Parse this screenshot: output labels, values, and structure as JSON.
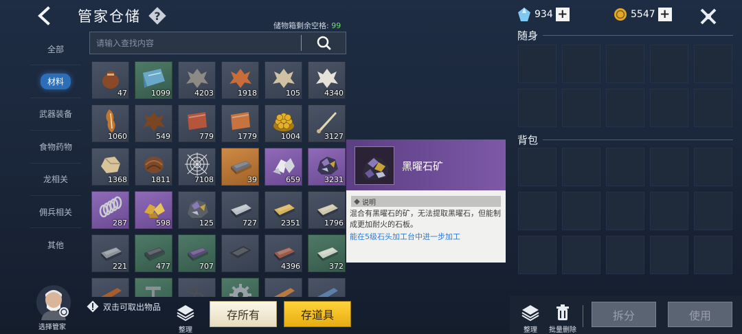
{
  "header": {
    "title": "管家仓储",
    "capacity_label": "储物箱剩余空格:",
    "capacity_value": "99"
  },
  "categories": [
    "全部",
    "材料",
    "武器装备",
    "食物药物",
    "龙相关",
    "佣兵相关",
    "其他"
  ],
  "active_category": "材料",
  "search": {
    "placeholder": "请输入查找内容"
  },
  "items": [
    {
      "name": "pouch-item",
      "qty": "47",
      "rarity": "white",
      "shape": "bag",
      "color": "#8a4a2a"
    },
    {
      "name": "cloth-item",
      "qty": "1099",
      "rarity": "green",
      "shape": "cloth",
      "color": "#6aa8c8"
    },
    {
      "name": "gray-hide-item",
      "qty": "4203",
      "rarity": "white",
      "shape": "hide",
      "color": "#8d8a86"
    },
    {
      "name": "orange-hide-item",
      "qty": "1918",
      "rarity": "white",
      "shape": "hide",
      "color": "#c86d3a"
    },
    {
      "name": "pale-hide-item",
      "qty": "105",
      "rarity": "white",
      "shape": "hide",
      "color": "#cfc1a2"
    },
    {
      "name": "white-hide-item",
      "qty": "4340",
      "rarity": "white",
      "shape": "hide",
      "color": "#e6e1d8"
    },
    {
      "name": "fox-pelt-item",
      "qty": "1060",
      "rarity": "white",
      "shape": "pelt",
      "color": "#c2762e"
    },
    {
      "name": "brown-leather-item",
      "qty": "549",
      "rarity": "white",
      "shape": "hide",
      "color": "#7a4522"
    },
    {
      "name": "red-leather-item",
      "qty": "779",
      "rarity": "white",
      "shape": "sheet",
      "color": "#b5553a"
    },
    {
      "name": "copper-leather-item",
      "qty": "1779",
      "rarity": "white",
      "shape": "sheet",
      "color": "#c7733f"
    },
    {
      "name": "gold-coins-item",
      "qty": "1004",
      "rarity": "white",
      "shape": "coins",
      "color": "#e0b12a"
    },
    {
      "name": "bone-spike-item",
      "qty": "3127",
      "rarity": "white",
      "shape": "spike",
      "color": "#e3d6b2"
    },
    {
      "name": "stone-item",
      "qty": "1368",
      "rarity": "white",
      "shape": "rock",
      "color": "#d8c39b"
    },
    {
      "name": "fur-item",
      "qty": "1811",
      "rarity": "white",
      "shape": "fur",
      "color": "#7b4a2a"
    },
    {
      "name": "spider-web-item",
      "qty": "7108",
      "rarity": "white",
      "shape": "web",
      "color": "#e8e8e8"
    },
    {
      "name": "iron-ingot-item",
      "qty": "39",
      "rarity": "orange",
      "shape": "ingot",
      "color": "#6a6f78"
    },
    {
      "name": "silver-ore-item",
      "qty": "659",
      "rarity": "purple",
      "shape": "crystal",
      "color": "#e9eaee"
    },
    {
      "name": "obsidian-ore-item",
      "qty": "3231",
      "rarity": "purple",
      "shape": "ore",
      "color": "#3a3550"
    },
    {
      "name": "spring-item",
      "qty": "287",
      "rarity": "purple",
      "shape": "spring",
      "color": "#c9ccd3"
    },
    {
      "name": "gold-ore-item",
      "qty": "598",
      "rarity": "purple",
      "shape": "nugget",
      "color": "#d8a93a"
    },
    {
      "name": "dark-ore-item",
      "qty": "125",
      "rarity": "white",
      "shape": "ore",
      "color": "#5a5f68"
    },
    {
      "name": "steel-bar-item",
      "qty": "727",
      "rarity": "white",
      "shape": "ingot",
      "color": "#b9bec6"
    },
    {
      "name": "gold-bar-item",
      "qty": "2351",
      "rarity": "white",
      "shape": "ingot",
      "color": "#d6b25a"
    },
    {
      "name": "stone-slab-item",
      "qty": "1796",
      "rarity": "white",
      "shape": "ingot",
      "color": "#cfc6ae"
    },
    {
      "name": "steel-ingot-item",
      "qty": "221",
      "rarity": "white",
      "shape": "ingot",
      "color": "#8e939b"
    },
    {
      "name": "dark-ingot-item",
      "qty": "477",
      "rarity": "green",
      "shape": "ingot",
      "color": "#3e444d"
    },
    {
      "name": "purple-ingot-item",
      "qty": "707",
      "rarity": "green",
      "shape": "ingot",
      "color": "#5a4a7a"
    },
    {
      "name": "black-plate-item",
      "qty": "",
      "rarity": "white",
      "shape": "plate",
      "color": "#35383e"
    },
    {
      "name": "red-brick-item",
      "qty": "4396",
      "rarity": "white",
      "shape": "ingot",
      "color": "#9a5a4a"
    },
    {
      "name": "green-slab-item",
      "qty": "372",
      "rarity": "green",
      "shape": "ingot",
      "color": "#c9d2c2"
    },
    {
      "name": "wood-plank-item",
      "qty": "",
      "rarity": "white",
      "shape": "plank",
      "color": "#a85e2a"
    },
    {
      "name": "nail-item",
      "qty": "",
      "rarity": "green",
      "shape": "nail",
      "color": "#8b8f96"
    },
    {
      "name": "chain-item",
      "qty": "",
      "rarity": "white",
      "shape": "chain",
      "color": "#4a4e55"
    },
    {
      "name": "gear-item",
      "qty": "",
      "rarity": "green",
      "shape": "gear",
      "color": "#9aa0a8"
    },
    {
      "name": "plank-item",
      "qty": "",
      "rarity": "white",
      "shape": "plank",
      "color": "#b87a3e"
    },
    {
      "name": "blue-plank-item",
      "qty": "",
      "rarity": "white",
      "shape": "plank",
      "color": "#5a7fa8"
    }
  ],
  "tooltip": {
    "name": "黑曜石矿",
    "section": "说明",
    "description": "混合有黑曜石的矿，无法提取黑曜石，但能制成更加耐火的石板。",
    "link": "能在5级石头加工台中进一步加工"
  },
  "bottom_left": {
    "npc_label": "选择管家",
    "tip": "双击可取出物品",
    "tidy_label": "整理",
    "store_all": "存所有",
    "store_tools": "存道具"
  },
  "currency": {
    "gems": "934",
    "coins": "5547"
  },
  "right": {
    "carry_title": "随身",
    "bag_title": "背包",
    "tidy_label": "整理",
    "bulk_delete_label": "批量删除",
    "split_label": "拆分",
    "use_label": "使用"
  },
  "colors": {
    "accent_blue": "#2c6fb8",
    "gold_button": "#f2c12a",
    "green_count": "#6fdc6f",
    "link_blue": "#2f7ad7",
    "tooltip_purple": "#6a4a92"
  }
}
